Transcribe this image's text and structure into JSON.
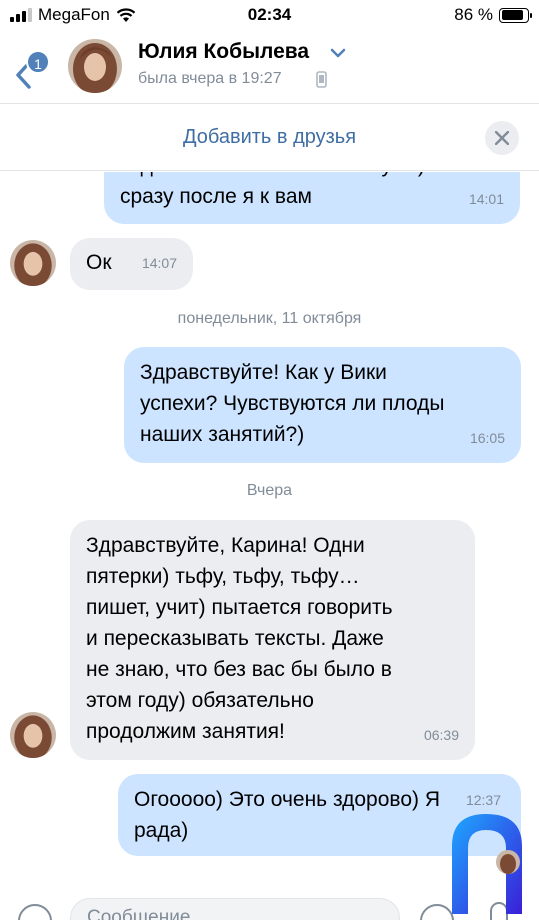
{
  "status_bar": {
    "carrier": "MegaFon",
    "time": "02:34",
    "battery_percent": "86 %",
    "battery_level": 0.86,
    "signal_bars_active": 3
  },
  "header": {
    "unread_count": "1",
    "contact_name": "Юлия Кобылева",
    "last_seen": "была вчера в 19:27"
  },
  "add_friend_bar": {
    "label": "Добавить в друзья"
  },
  "messages": [
    {
      "direction": "out",
      "text_partial": "код вспоминают от шлагбаума) и",
      "text": "сразу после я к вам",
      "time": "14:01"
    },
    {
      "direction": "in",
      "text": "Ок",
      "time": "14:07"
    },
    {
      "type": "divider",
      "text": "понедельник, 11 октября"
    },
    {
      "direction": "out",
      "lines": [
        "Здравствуйте! Как у Вики",
        "успехи? Чувствуются ли плоды",
        "наших занятий?)"
      ],
      "time": "16:05"
    },
    {
      "type": "divider",
      "text": "Вчера"
    },
    {
      "direction": "in",
      "lines": [
        "Здравствуйте, Карина! Одни",
        "пятерки) тьфу, тьфу, тьфу…",
        "пишет, учит) пытается говорить",
        "и пересказывать тексты. Даже",
        "не знаю, что без вас бы было в",
        "этом году) обязательно",
        "продолжим занятия!"
      ],
      "time": "06:39"
    },
    {
      "direction": "out",
      "lines": [
        "Огооооо) Это очень здорово) Я",
        "рада)"
      ],
      "time": "12:37"
    }
  ],
  "input_bar": {
    "placeholder": "Сообщение"
  },
  "colors": {
    "accent": "#5181b8",
    "link": "#3f6ea3",
    "outgoing_bubble": "#cce4ff",
    "incoming_bubble": "#ebedf0",
    "secondary_text": "#818c99"
  },
  "icons": [
    "back-chevron-icon",
    "chevron-down-icon",
    "phone-icon",
    "close-icon",
    "wifi-icon",
    "battery-icon",
    "signal-icon",
    "attach-icon",
    "sticker-icon",
    "mic-icon"
  ]
}
